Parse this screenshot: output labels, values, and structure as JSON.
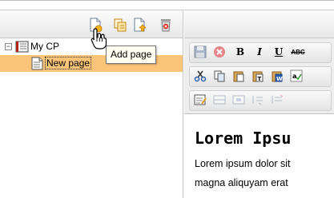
{
  "window": {
    "title": ""
  },
  "page_tree_toolbar": {
    "buttons": [
      {
        "icon": "add-page-icon",
        "tooltip": "Add page"
      },
      {
        "icon": "copy-page-icon"
      },
      {
        "icon": "move-page-up-icon"
      },
      {
        "icon": "delete-page-icon"
      }
    ]
  },
  "tooltip": {
    "text": "Add page"
  },
  "tree": {
    "items": [
      {
        "label": "My CP",
        "icon": "book-icon",
        "expander": "⊟",
        "selected": false
      },
      {
        "label": "New page",
        "icon": "page-icon",
        "selected": true
      }
    ]
  },
  "editor_toolbar": {
    "row1": [
      {
        "icon": "save-icon"
      },
      {
        "icon": "cancel-icon"
      },
      {
        "label": "B"
      },
      {
        "label": "I"
      },
      {
        "label": "U"
      },
      {
        "label": "ABC"
      }
    ],
    "row2": [
      {
        "icon": "cut-icon"
      },
      {
        "icon": "copy-icon"
      },
      {
        "icon": "paste-icon"
      },
      {
        "icon": "paste-text-icon"
      },
      {
        "icon": "paste-word-icon"
      },
      {
        "icon": "spellcheck-icon"
      }
    ],
    "row3": [
      {
        "icon": "edit-source-icon"
      },
      {
        "icon": "table-icon"
      },
      {
        "icon": "table-cell-icon"
      },
      {
        "icon": "indent-icon"
      },
      {
        "icon": "outdent-icon"
      }
    ]
  },
  "content": {
    "heading": "Lorem Ipsu",
    "lines": [
      "Lorem ipsum dolor sit",
      "magna aliquyam erat"
    ]
  },
  "colors": {
    "selected_row": "#fcc478",
    "tooltip_bg": "#fffff1",
    "toolbar_bg": "#eeeeee"
  }
}
